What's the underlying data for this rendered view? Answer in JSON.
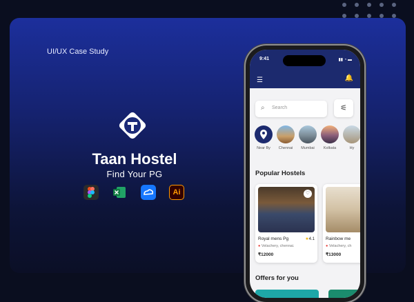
{
  "page": {
    "eyebrow": "UI/UX Case Study",
    "title": "Taan Hostel",
    "subtitle": "Find Your PG",
    "accent": "#1c2f9c"
  },
  "tools": [
    {
      "name": "figma",
      "icon": "figma-icon"
    },
    {
      "name": "excel",
      "icon": "excel-icon"
    },
    {
      "name": "teal-app",
      "icon": "cloud-icon"
    },
    {
      "name": "illustrator",
      "icon": "illustrator-icon",
      "label": "Ai"
    }
  ],
  "app": {
    "status_time": "9:41",
    "search_placeholder": "Search",
    "cities": [
      {
        "label": "Near By"
      },
      {
        "label": "Chennai"
      },
      {
        "label": "Mumbai"
      },
      {
        "label": "Kolkata"
      },
      {
        "label": "Hy"
      }
    ],
    "popular_title": "Popular Hostels",
    "hostels": [
      {
        "name": "Royal mens Pg",
        "rating": "4.1",
        "location": "Velachery, chennai.",
        "price": "₹12000"
      },
      {
        "name": "Rainbow me",
        "location": "Velachery, ch",
        "price": "₹13000"
      }
    ],
    "offers_title": "Offers for you"
  }
}
